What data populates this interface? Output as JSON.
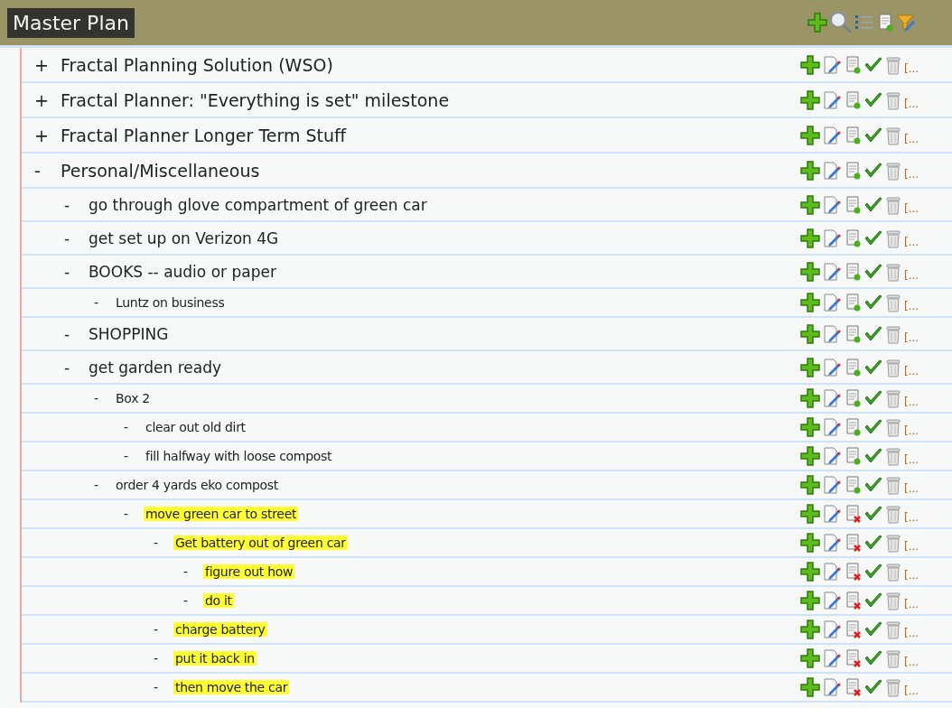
{
  "title": "Master Plan",
  "items": [
    {
      "marker": "+",
      "text": "Fractal Planning Solution (WSO)",
      "highlighted": false,
      "more": "[..."
    },
    {
      "marker": "+",
      "text": "Fractal Planner: \"Everything is set\" milestone",
      "highlighted": false,
      "more": "[..."
    },
    {
      "marker": "+",
      "text": "Fractal Planner Longer Term Stuff",
      "highlighted": false,
      "more": "[..."
    },
    {
      "marker": "-",
      "text": "Personal/Miscellaneous",
      "highlighted": false,
      "more": "[...",
      "children": [
        {
          "marker": "-",
          "text": "go through glove compartment of green car",
          "highlighted": false,
          "more": "[..."
        },
        {
          "marker": "-",
          "text": "get set up on Verizon 4G",
          "highlighted": false,
          "more": "[..."
        },
        {
          "marker": "-",
          "text": "BOOKS -- audio or paper",
          "highlighted": false,
          "more": "[...",
          "children": [
            {
              "marker": "-",
              "text": "Luntz on business",
              "highlighted": false,
              "more": "[..."
            }
          ]
        },
        {
          "marker": "-",
          "text": "SHOPPING",
          "highlighted": false,
          "more": "[..."
        },
        {
          "marker": "-",
          "text": "get garden ready",
          "highlighted": false,
          "more": "[...",
          "children": [
            {
              "marker": "-",
              "text": "Box 2",
              "highlighted": false,
              "more": "[...",
              "children": [
                {
                  "marker": "-",
                  "text": "clear out old dirt",
                  "highlighted": false,
                  "more": "[..."
                },
                {
                  "marker": "-",
                  "text": "fill halfway with loose compost",
                  "highlighted": false,
                  "more": "[..."
                }
              ]
            },
            {
              "marker": "-",
              "text": "order 4 yards eko compost",
              "highlighted": false,
              "more": "[...",
              "children": [
                {
                  "marker": "-",
                  "text": "move green car to street",
                  "highlighted": true,
                  "more": "[...",
                  "children": [
                    {
                      "marker": "-",
                      "text": "Get battery out of green car",
                      "highlighted": true,
                      "more": "[...",
                      "children": [
                        {
                          "marker": "-",
                          "text": "figure out how",
                          "highlighted": true,
                          "more": "[..."
                        },
                        {
                          "marker": "-",
                          "text": "do it",
                          "highlighted": true,
                          "more": "[..."
                        }
                      ]
                    },
                    {
                      "marker": "-",
                      "text": "charge battery",
                      "highlighted": true,
                      "more": "[..."
                    },
                    {
                      "marker": "-",
                      "text": "put it back in",
                      "highlighted": true,
                      "more": "[..."
                    },
                    {
                      "marker": "-",
                      "text": "then move the car",
                      "highlighted": true,
                      "more": "[..."
                    }
                  ]
                }
              ]
            }
          ]
        }
      ]
    }
  ]
}
